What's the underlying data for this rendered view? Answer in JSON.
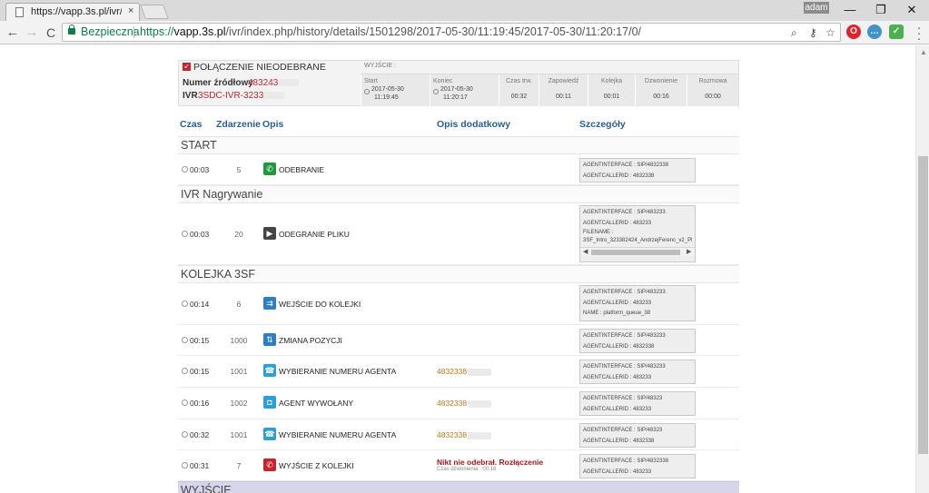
{
  "browser": {
    "tab_title": "https://vapp.3s.pl/ivr/ind",
    "tab_close": "×",
    "user_badge": "adam",
    "secure_label": "Bezpieczna",
    "url_scheme": "https://",
    "url_host": "vapp.3s.pl",
    "url_path": "/ivr/index.php/history/details/1501298/2017-05-30/11:19:45/2017-05-30/11:20:17/0/",
    "window": {
      "minimize": "—",
      "maximize": "❐",
      "close": "✕"
    },
    "nav": {
      "back": "←",
      "forward": "→",
      "reload": "C"
    }
  },
  "summary": {
    "status": "Połączenie nieodebrane",
    "source_label": "Numer źródłowy",
    "source_value": "483243",
    "ivr_label": "IVR",
    "ivr_value": "3SDC-IVR-3233",
    "exit_label": "WYJŚCIE :",
    "start": {
      "label": "Start",
      "date": "2017-05-30",
      "time": "11:19:45"
    },
    "end": {
      "label": "Koniec",
      "date": "2017-05-30",
      "time": "11:20:17"
    },
    "metrics": [
      {
        "label": "Czas trw.",
        "value": "00:32"
      },
      {
        "label": "Zapowiedź",
        "value": "00:11"
      },
      {
        "label": "Kolejka",
        "value": "00:01"
      },
      {
        "label": "Dzwonienie",
        "value": "00:16"
      },
      {
        "label": "Rozmowa",
        "value": "00:00"
      }
    ]
  },
  "columns": {
    "time": "Czas",
    "event": "Zdarzenie",
    "description": "Opis",
    "extra": "Opis dodatkowy",
    "details": "Szczegóły"
  },
  "sections": {
    "start": "START",
    "ivr": "IVR Nagrywanie",
    "queue": "KOLEJKA 3SF",
    "exit": "WYJŚCIE"
  },
  "rows": [
    {
      "time": "00:03",
      "event": "5",
      "desc": "Odebranie",
      "extra": "",
      "details": [
        "AGENTINTERFACE : SIP/4832338",
        "AGENTCALLERID : 4832338"
      ]
    },
    {
      "time": "00:03",
      "event": "20",
      "desc": "Odegranie pliku",
      "extra": "",
      "details": [
        "AGENTINTERFACE : SIP/483233",
        "AGENTCALLERID : 483233",
        "FILENAME :",
        "3SF_Intro_323382424_AndrzejFerenc_v2_Pl"
      ]
    },
    {
      "time": "00:14",
      "event": "6",
      "desc": "Wejście do kolejki",
      "extra": "",
      "details": [
        "AGENTINTERFACE : SIP/483233",
        "AGENTCALLERID : 483233",
        "NAME : platform_queue_38"
      ]
    },
    {
      "time": "00:15",
      "event": "1000",
      "desc": "Zmiana pozycji",
      "extra": "",
      "details": [
        "AGENTINTERFACE : SIP/483233",
        "AGENTCALLERID : 4832338"
      ]
    },
    {
      "time": "00:15",
      "event": "1001",
      "desc": "Wybieranie numeru agenta",
      "extra": "4832338",
      "details": [
        "AGENTINTERFACE : SIP/483233",
        "AGENTCALLERID : 483233"
      ]
    },
    {
      "time": "00:16",
      "event": "1002",
      "desc": "Agent wywołany",
      "extra": "4832338",
      "details": [
        "AGENTINTERFACE : SIP/48323",
        "AGENTCALLERID : 483233"
      ]
    },
    {
      "time": "00:32",
      "event": "1001",
      "desc": "Wybieranie numeru agenta",
      "extra": "4832338",
      "details": [
        "AGENTINTERFACE : SIP/48323",
        "AGENTCALLERID : 4832338"
      ]
    },
    {
      "time": "00:31",
      "event": "7",
      "desc": "Wyjście z kolejki",
      "extra": "Nikt nie odebrał. Rozłączenie",
      "extra_sub": "Czas dzwonienia : 00:16",
      "details": [
        "AGENTINTERFACE : SIP/4832338",
        "AGENTCALLERID : 483233"
      ]
    }
  ],
  "colors": {
    "link_blue": "#2a5e8f",
    "alert_red": "#c0262d",
    "number_orange": "#c07a14",
    "icon_green": "#1f9a3b",
    "icon_blue": "#2b7fc2",
    "icon_dark": "#444444",
    "icon_red": "#c8222c"
  },
  "icons": [
    "phone-answer-icon",
    "play-file-icon",
    "queue-enter-icon",
    "queue-position-icon",
    "dial-agent-icon",
    "agent-ring-icon",
    "dial-agent-icon",
    "queue-exit-icon"
  ]
}
